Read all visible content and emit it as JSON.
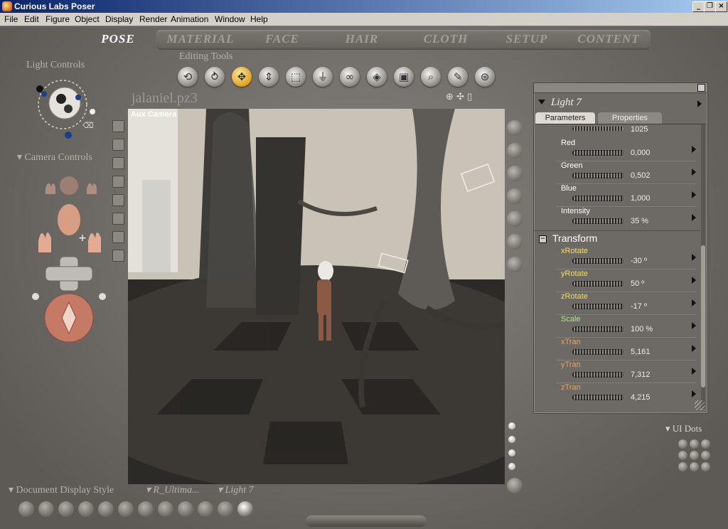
{
  "window": {
    "title": "Curious Labs Poser",
    "controls": [
      "_",
      "❐",
      "×"
    ]
  },
  "menu": [
    "File",
    "Edit",
    "Figure",
    "Object",
    "Display",
    "Render",
    "Animation",
    "Window",
    "Help"
  ],
  "tabs": [
    "POSE",
    "MATERIAL",
    "FACE",
    "HAIR",
    "CLOTH",
    "SETUP",
    "CONTENT"
  ],
  "left": {
    "light_controls": "Light Controls",
    "camera_controls": "Camera Controls"
  },
  "editing_tools": {
    "title": "Editing Tools",
    "tools": [
      "rotate-tool-icon",
      "twist-tool-icon",
      "translate-tool-icon",
      "translate-in-out-icon",
      "scale-tool-icon",
      "taper-tool-icon",
      "chain-break-icon",
      "color-tool-icon",
      "grouping-tool-icon",
      "view-magnifier-icon",
      "morph-tool-icon",
      "direct-manipulation-icon"
    ],
    "active_index": 2
  },
  "document": {
    "filename": "jalaniel.pz3",
    "camera_label": "Aux Camera"
  },
  "param_panel": {
    "title": "Light 7",
    "tabs": [
      "Parameters",
      "Properties"
    ],
    "top_value": "1025",
    "rows": [
      {
        "label": "Red",
        "value": "0,000",
        "color": "#ffffff"
      },
      {
        "label": "Green",
        "value": "0,502",
        "color": "#ffffff"
      },
      {
        "label": "Blue",
        "value": "1,000",
        "color": "#ffffff"
      },
      {
        "label": "Intensity",
        "value": "35 %",
        "color": "#ffffff"
      }
    ],
    "group": "Transform",
    "transform_rows": [
      {
        "label": "xRotate",
        "value": "-30 º",
        "color": "#f0e060"
      },
      {
        "label": "yRotate",
        "value": "50 º",
        "color": "#f0e060"
      },
      {
        "label": "zRotate",
        "value": "-17 º",
        "color": "#f0e060"
      },
      {
        "label": "Scale",
        "value": "100 %",
        "color": "#a8e880"
      },
      {
        "label": "xTran",
        "value": "5,161",
        "color": "#f0a050"
      },
      {
        "label": "yTran",
        "value": "7,312",
        "color": "#f0a050"
      },
      {
        "label": "zTran",
        "value": "4,215",
        "color": "#f0a050"
      }
    ]
  },
  "bottom": {
    "doc_display_style": "Document Display Style",
    "render_mode": "R_Ultima...",
    "light_select": "Light 7",
    "ui_dots": "UI Dots"
  }
}
